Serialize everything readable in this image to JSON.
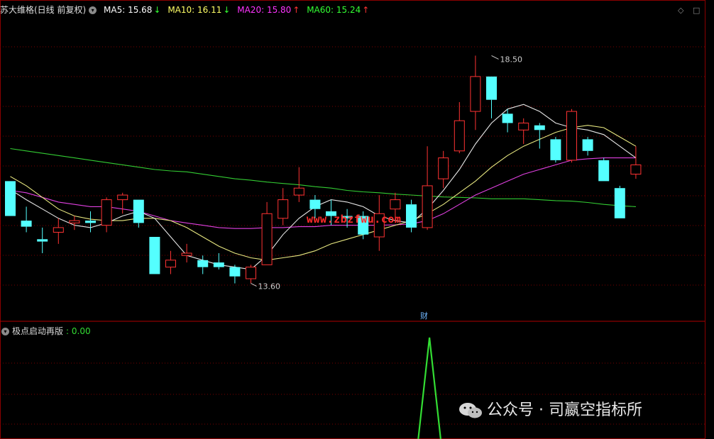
{
  "header": {
    "stock_title": "苏大维格(日线 前复权)",
    "ma5": {
      "label": "MA5: 15.68",
      "arrow": "↓",
      "color": "#ffffff"
    },
    "ma10": {
      "label": "MA10: 16.11",
      "arrow": "↓",
      "color": "#ffff66"
    },
    "ma20": {
      "label": "MA20: 15.80",
      "arrow": "↑",
      "color": "#ff33ff"
    },
    "ma60": {
      "label": "MA60: 15.24",
      "arrow": "↑",
      "color": "#33ff33"
    }
  },
  "indicator": {
    "name": "极点启动再版",
    "value": ": 0.00",
    "color": "#33dd33"
  },
  "watermarks": {
    "site": "www.zbzfwu.com",
    "account": "公众号 · 司嬴空指标所"
  },
  "markers": {
    "finance_label": "财"
  },
  "chart_data": {
    "type": "candlestick",
    "title": "苏大维格(日线 前复权)",
    "price_range": [
      12.8,
      19.3
    ],
    "high_annotation": {
      "index": 30,
      "value": 18.5,
      "label": "18.50"
    },
    "low_annotation": {
      "index": 15,
      "value": 13.6,
      "label": "13.60"
    },
    "colors": {
      "up": "#ff3333",
      "down": "#54ffff",
      "ma5": "#e6e6e6",
      "ma10": "#e8e880",
      "ma20": "#e040e0",
      "ma60": "#33cc33"
    },
    "candles": [
      {
        "o": 15.8,
        "c": 15.05,
        "h": 15.8,
        "l": 15.05
      },
      {
        "o": 14.95,
        "c": 14.82,
        "h": 15.25,
        "l": 14.7
      },
      {
        "o": 14.55,
        "c": 14.5,
        "h": 14.8,
        "l": 14.25
      },
      {
        "o": 14.7,
        "c": 14.8,
        "h": 15.0,
        "l": 14.45
      },
      {
        "o": 14.9,
        "c": 14.95,
        "h": 15.05,
        "l": 14.75
      },
      {
        "o": 14.95,
        "c": 14.9,
        "h": 15.15,
        "l": 14.7
      },
      {
        "o": 14.85,
        "c": 15.4,
        "h": 15.45,
        "l": 14.7
      },
      {
        "o": 15.4,
        "c": 15.5,
        "h": 15.55,
        "l": 15.1
      },
      {
        "o": 15.4,
        "c": 14.9,
        "h": 15.4,
        "l": 14.8
      },
      {
        "o": 14.6,
        "c": 13.8,
        "h": 14.6,
        "l": 13.8
      },
      {
        "o": 13.95,
        "c": 14.1,
        "h": 14.3,
        "l": 13.8
      },
      {
        "o": 14.2,
        "c": 14.25,
        "h": 14.45,
        "l": 14.05
      },
      {
        "o": 14.1,
        "c": 13.95,
        "h": 14.2,
        "l": 13.8
      },
      {
        "o": 14.05,
        "c": 13.95,
        "h": 14.25,
        "l": 13.9
      },
      {
        "o": 13.95,
        "c": 13.75,
        "h": 14.0,
        "l": 13.6
      },
      {
        "o": 13.7,
        "c": 13.95,
        "h": 14.0,
        "l": 13.6
      },
      {
        "o": 14.0,
        "c": 15.1,
        "h": 15.35,
        "l": 14.0
      },
      {
        "o": 15.0,
        "c": 15.4,
        "h": 15.65,
        "l": 14.85
      },
      {
        "o": 15.5,
        "c": 15.65,
        "h": 16.1,
        "l": 15.35
      },
      {
        "o": 15.4,
        "c": 15.2,
        "h": 15.5,
        "l": 15.0
      },
      {
        "o": 15.15,
        "c": 15.05,
        "h": 15.4,
        "l": 14.85
      },
      {
        "o": 15.05,
        "c": 15.0,
        "h": 15.2,
        "l": 14.8
      },
      {
        "o": 15.05,
        "c": 14.65,
        "h": 15.15,
        "l": 14.55
      },
      {
        "o": 14.6,
        "c": 15.1,
        "h": 15.5,
        "l": 14.3
      },
      {
        "o": 15.2,
        "c": 15.4,
        "h": 15.55,
        "l": 14.9
      },
      {
        "o": 15.3,
        "c": 14.8,
        "h": 15.4,
        "l": 14.7
      },
      {
        "o": 14.8,
        "c": 15.7,
        "h": 16.55,
        "l": 14.75
      },
      {
        "o": 15.85,
        "c": 16.3,
        "h": 16.45,
        "l": 15.65
      },
      {
        "o": 16.45,
        "c": 17.1,
        "h": 17.5,
        "l": 16.4
      },
      {
        "o": 17.3,
        "c": 18.05,
        "h": 18.5,
        "l": 16.9
      },
      {
        "o": 18.05,
        "c": 17.55,
        "h": 18.05,
        "l": 17.15
      },
      {
        "o": 17.25,
        "c": 17.05,
        "h": 17.35,
        "l": 16.85
      },
      {
        "o": 16.9,
        "c": 17.05,
        "h": 17.15,
        "l": 16.6
      },
      {
        "o": 17.0,
        "c": 16.9,
        "h": 17.05,
        "l": 16.5
      },
      {
        "o": 16.7,
        "c": 16.25,
        "h": 16.75,
        "l": 16.2
      },
      {
        "o": 16.25,
        "c": 17.3,
        "h": 17.35,
        "l": 16.2
      },
      {
        "o": 16.7,
        "c": 16.45,
        "h": 16.75,
        "l": 16.35
      },
      {
        "o": 16.25,
        "c": 15.8,
        "h": 16.3,
        "l": 15.8
      },
      {
        "o": 15.65,
        "c": 15.0,
        "h": 15.7,
        "l": 15.0
      },
      {
        "o": 15.95,
        "c": 16.15,
        "h": 16.55,
        "l": 15.85
      }
    ],
    "ma5": [
      15.62,
      15.4,
      15.2,
      15.0,
      14.85,
      14.8,
      14.9,
      15.05,
      15.15,
      15.0,
      14.6,
      14.2,
      14.1,
      14.0,
      13.95,
      13.9,
      14.2,
      14.65,
      15.0,
      15.25,
      15.4,
      15.35,
      15.25,
      15.05,
      14.95,
      14.9,
      15.2,
      15.6,
      16.05,
      16.6,
      17.05,
      17.35,
      17.45,
      17.3,
      17.05,
      16.95,
      16.9,
      16.8,
      16.55,
      16.3
    ],
    "ma10": [
      15.9,
      15.7,
      15.45,
      15.2,
      15.05,
      14.98,
      14.95,
      14.95,
      15.0,
      15.0,
      14.95,
      14.8,
      14.6,
      14.4,
      14.25,
      14.15,
      14.1,
      14.15,
      14.2,
      14.3,
      14.45,
      14.55,
      14.65,
      14.75,
      14.85,
      14.95,
      15.1,
      15.3,
      15.55,
      15.8,
      16.1,
      16.35,
      16.55,
      16.7,
      16.85,
      16.95,
      17.0,
      16.95,
      16.75,
      16.55
    ],
    "ma20": [
      15.6,
      15.55,
      15.45,
      15.35,
      15.3,
      15.25,
      15.25,
      15.2,
      15.15,
      15.05,
      14.95,
      14.9,
      14.85,
      14.8,
      14.78,
      14.78,
      14.8,
      14.8,
      14.82,
      14.82,
      14.85,
      14.85,
      14.85,
      14.85,
      14.86,
      14.88,
      14.95,
      15.1,
      15.3,
      15.5,
      15.65,
      15.8,
      15.95,
      16.05,
      16.15,
      16.25,
      16.28,
      16.3,
      16.3,
      16.3
    ],
    "ma60": [
      16.5,
      16.45,
      16.4,
      16.35,
      16.3,
      16.25,
      16.2,
      16.15,
      16.1,
      16.05,
      16.02,
      16.0,
      15.95,
      15.9,
      15.85,
      15.82,
      15.78,
      15.75,
      15.72,
      15.68,
      15.65,
      15.6,
      15.57,
      15.55,
      15.52,
      15.5,
      15.48,
      15.46,
      15.45,
      15.44,
      15.42,
      15.42,
      15.42,
      15.4,
      15.38,
      15.37,
      15.34,
      15.3,
      15.27,
      15.25
    ],
    "indicator_series": {
      "name": "极点启动再版",
      "values": [
        0,
        0,
        0,
        0,
        0,
        0,
        0,
        0,
        0,
        0,
        0,
        0,
        0,
        0,
        0,
        0,
        0,
        0,
        0,
        0,
        0,
        0,
        0,
        0,
        0,
        0,
        1,
        0,
        0,
        0,
        0,
        0,
        0,
        0,
        0,
        0,
        0,
        0,
        0,
        0
      ]
    }
  }
}
